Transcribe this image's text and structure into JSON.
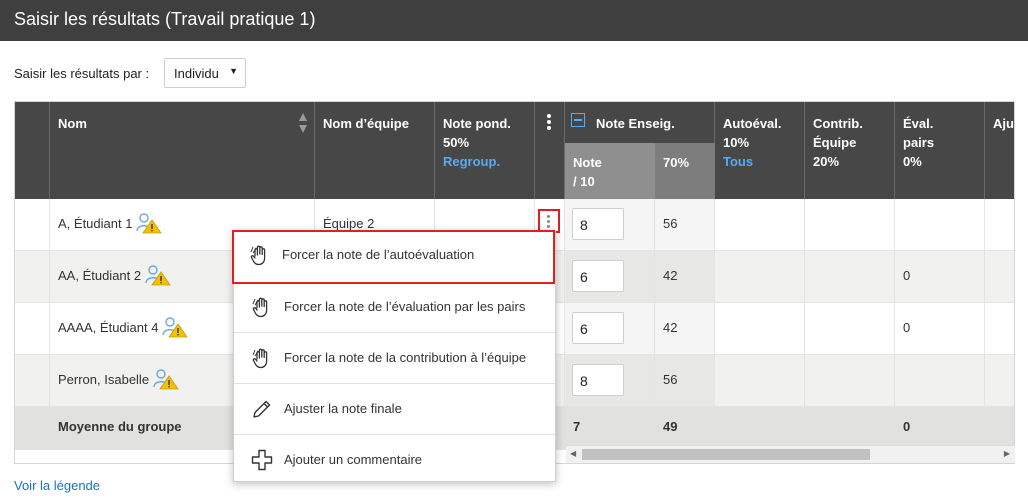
{
  "title": "Saisir les résultats (Travail pratique 1)",
  "entry_mode": {
    "label": "Saisir les résultats par :",
    "value": "Individu"
  },
  "headers": {
    "name": "Nom",
    "team": "Nom d’équipe",
    "weighted": {
      "l1": "Note pond.",
      "l2": "50%",
      "link": "Regroup."
    },
    "teacher": {
      "label": "Note Enseig.",
      "sub_note": "Note",
      "sub_scale": "/ 10",
      "sub_pct": "70%"
    },
    "self_eval": {
      "l1": "Autoéval.",
      "l2": "10%",
      "link": "Tous"
    },
    "contrib": {
      "l1": "Contrib.",
      "l2": "Équipe",
      "l3": "20%"
    },
    "peer": {
      "l1": "Éval.",
      "l2": "pairs",
      "l3": "0%"
    },
    "adjust": "Ajus"
  },
  "rows": [
    {
      "name": "A, Étudiant 1",
      "team": "Équipe 2",
      "note": "8",
      "pct": "56",
      "peer": ""
    },
    {
      "name": "AA, Étudiant 2",
      "team": "",
      "note": "6",
      "pct": "42",
      "peer": "0"
    },
    {
      "name": "AAAA, Étudiant 4",
      "team": "",
      "note": "6",
      "pct": "42",
      "peer": "0"
    },
    {
      "name": "Perron, Isabelle",
      "team": "",
      "note": "8",
      "pct": "56",
      "peer": ""
    }
  ],
  "average": {
    "label": "Moyenne du groupe",
    "note": "7",
    "pct": "49",
    "peer": "0"
  },
  "menu": [
    {
      "label": "Forcer la note de l’autoévaluation",
      "icon": "hand-icon"
    },
    {
      "label": "Forcer la note de l’évaluation par les pairs",
      "icon": "hand-icon"
    },
    {
      "label": "Forcer la note de la contribution à l’équipe",
      "icon": "hand-icon"
    },
    {
      "label": "Ajuster la note finale",
      "icon": "pencil-icon"
    },
    {
      "label": "Ajouter un commentaire",
      "icon": "plus-icon"
    }
  ],
  "legend_link": "Voir la légende",
  "colors": {
    "header": "#474747",
    "subheader": "#8f8f8f",
    "link": "#5aaaf0",
    "highlight": "#e02020",
    "warning": "#f2c200"
  }
}
